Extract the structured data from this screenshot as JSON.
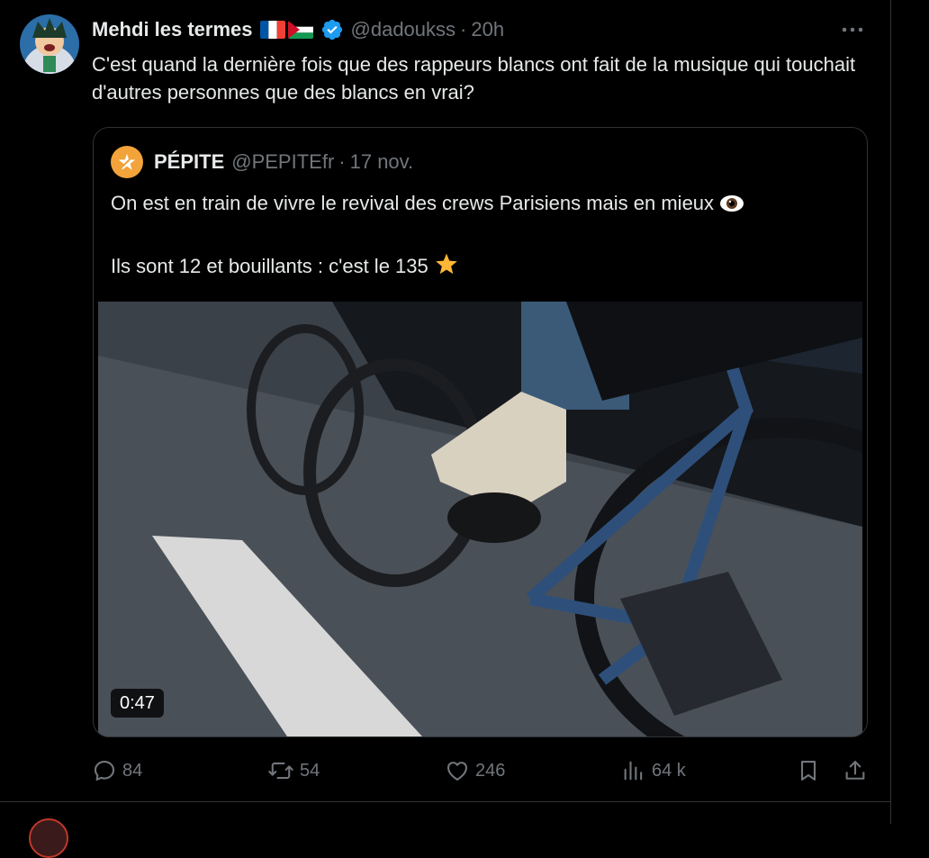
{
  "tweet": {
    "author": {
      "display_name": "Mehdi les termes",
      "flags": [
        "france-flag",
        "palestine-flag"
      ],
      "verified_icon": "verified-badge-icon",
      "handle": "@dadoukss",
      "separator": "·",
      "time": "20h"
    },
    "more_icon": "more-icon",
    "text": "C'est quand la dernière fois que des rappeurs blancs ont fait de la musique qui touchait d'autres personnes que des blancs en vrai?",
    "quote": {
      "display_name": "PÉPITE",
      "handle": "@PEPITEfr",
      "separator": "·",
      "date": "17 nov.",
      "line1": "On est en train de vivre le revival des crews Parisiens mais en mieux",
      "line1_emoji": "eye-emoji",
      "line2": "Ils sont 12 et bouillants : c'est le 135",
      "line2_emoji": "star-emoji",
      "video": {
        "duration": "0:47"
      }
    },
    "actions": {
      "replies": {
        "icon": "reply-icon",
        "count": "84"
      },
      "reposts": {
        "icon": "repost-icon",
        "count": "54"
      },
      "likes": {
        "icon": "heart-icon",
        "count": "246"
      },
      "views": {
        "icon": "views-icon",
        "count": "64 k"
      },
      "bookmark": {
        "icon": "bookmark-icon"
      },
      "share": {
        "icon": "share-icon"
      }
    }
  },
  "colors": {
    "background": "#000000",
    "text_primary": "#e7e9ea",
    "text_secondary": "#71767b",
    "border": "#2f3336",
    "verified_blue": "#1d9bf0",
    "pepite_orange": "#f2a33a"
  }
}
